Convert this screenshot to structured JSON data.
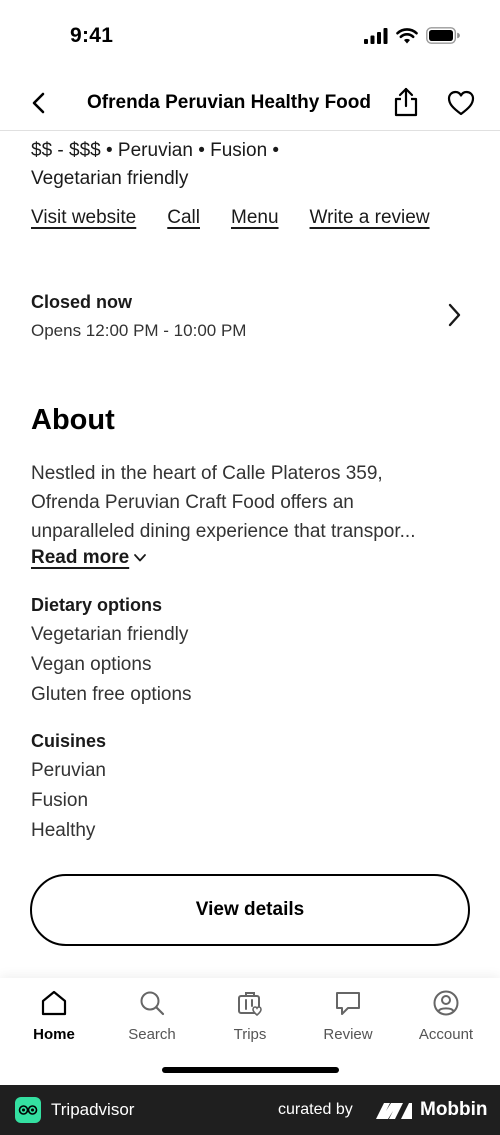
{
  "status_bar": {
    "time": "9:41",
    "icons": [
      "signal-icon",
      "wifi-icon",
      "battery-icon"
    ]
  },
  "header": {
    "title": "Ofrenda Peruvian Healthy Food",
    "icons": [
      "back-arrow-icon",
      "share-icon",
      "heart-icon"
    ]
  },
  "restaurant": {
    "meta_line1": "$$ - $$$ • Peruvian • Fusion •",
    "meta_line2": "Vegetarian friendly",
    "links": {
      "visit_website": "Visit website",
      "call": "Call",
      "menu": "Menu",
      "write_review": "Write a review"
    },
    "hours": {
      "status": "Closed now",
      "opens": "Opens 12:00 PM - 10:00 PM"
    }
  },
  "about": {
    "title": "About",
    "lines": [
      "Nestled in the heart of Calle Plateros 359,",
      "Ofrenda Peruvian Craft Food offers an",
      "unparalleled dining experience that transpor..."
    ],
    "read_more": "Read more"
  },
  "dietary": {
    "heading": "Dietary options",
    "items": [
      "Vegetarian friendly",
      "Vegan options",
      "Gluten free options"
    ]
  },
  "cuisines": {
    "heading": "Cuisines",
    "items": [
      "Peruvian",
      "Fusion",
      "Healthy"
    ]
  },
  "view_details_label": "View details",
  "tab_bar": {
    "tabs": [
      {
        "label": "Home",
        "icon": "home-icon",
        "active": true
      },
      {
        "label": "Search",
        "icon": "search-icon",
        "active": false
      },
      {
        "label": "Trips",
        "icon": "trips-icon",
        "active": false
      },
      {
        "label": "Review",
        "icon": "review-icon",
        "active": false
      },
      {
        "label": "Account",
        "icon": "account-icon",
        "active": false
      }
    ]
  },
  "footer": {
    "brand": "Tripadvisor",
    "curated_by": "curated by",
    "mobbin": "Mobbin"
  },
  "colors": {
    "text": "#1a1a1a",
    "footer_bg": "#1f1f1f",
    "tripadvisor_green": "#34e0a1"
  }
}
